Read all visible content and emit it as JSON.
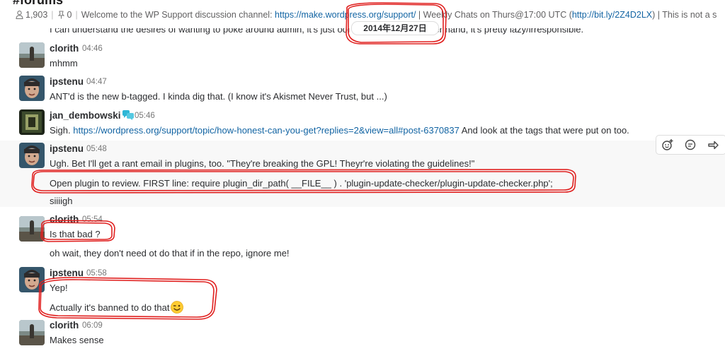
{
  "channel": {
    "name": "#forums",
    "member_count": "1,903",
    "pinned_count": "0",
    "topic_prefix": "Welcome to the WP Support discussion channel: ",
    "topic_link": "https://make.wordpress.org/support/",
    "topic_mid": " | Weekly Chats on Thurs@17:00 UTC (",
    "topic_link2": "http://bit.ly/2Z4D2LX",
    "topic_tail": ") | This is not a s"
  },
  "date_divider": "2014年12月27日",
  "previous_line": "I can understand the desires of wanting to poke around admin, it's  just                           oof that way. On the other hand, it's pretty lazy/irresponsible.",
  "messages": [
    {
      "author": "clorith",
      "time": "04:46",
      "lines": [
        "mhmm"
      ]
    },
    {
      "author": "ipstenu",
      "time": "04:47",
      "lines": [
        "ANT'd is the new b-tagged. I kinda dig that. (I know it's Akismet Never Trust, but ...)"
      ]
    },
    {
      "author": "jan_dembowski",
      "time": "05:46",
      "prefix": "Sigh. ",
      "link": "https://wordpress.org/support/topic/how-honest-can-you-get?replies=2&view=all#post-6370837",
      "suffix": " And look at the tags that were put on too."
    },
    {
      "author": "ipstenu",
      "time": "05:48",
      "lines": [
        "Ugh. Bet I'll get a rant email in plugins, too. \"They're breaking the GPL! Theyr're violating the guidelines!\"",
        "Open plugin to review. FIRST line: require plugin_dir_path( __FILE__ ) . 'plugin-update-checker/plugin-update-checker.php';",
        "siiiigh"
      ]
    },
    {
      "author": "clorith",
      "time": "05:54",
      "lines": [
        "Is that bad ?",
        "oh wait, they don't need ot do that if in the repo, ignore me!"
      ]
    },
    {
      "author": "ipstenu",
      "time": "05:58",
      "lines": [
        "Yep!",
        "Actually it's banned to do that"
      ]
    },
    {
      "author": "clorith",
      "time": "06:09",
      "lines": [
        "Makes sense"
      ]
    }
  ],
  "icons": {
    "members": "person-icon",
    "pinned": "pin-icon",
    "verified": "chat-bubbles-icon",
    "wink": "wink-emoji",
    "reaction": "add-reaction-icon",
    "thread": "reply-thread-icon",
    "share": "share-arrow-icon"
  },
  "colors": {
    "link": "#1264a3",
    "annotation": "#e0201f",
    "hover": "#f8f8f8",
    "verified": "#2eb6d6"
  }
}
